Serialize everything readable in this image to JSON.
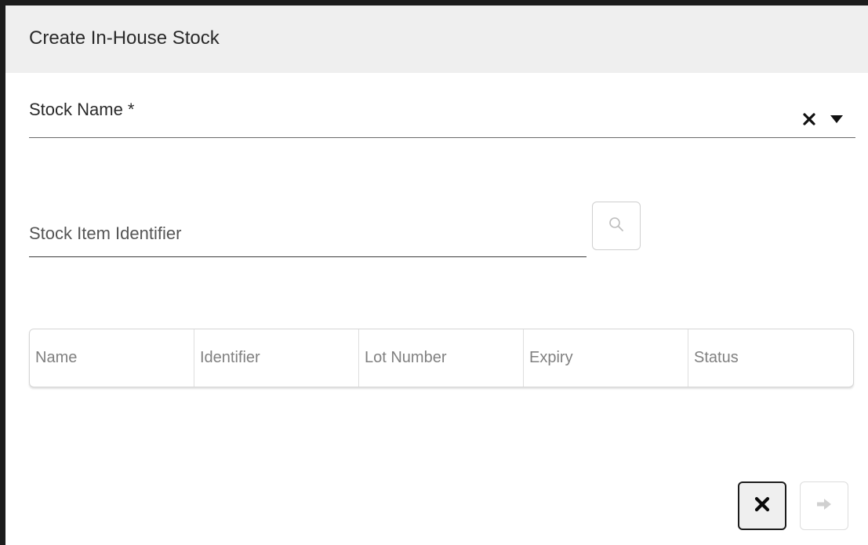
{
  "dialog": {
    "title": "Create In-House Stock"
  },
  "stock_name": {
    "label": "Stock Name *",
    "value": "",
    "icons": {
      "clear": "close-icon",
      "dropdown": "caret-down-icon"
    }
  },
  "identifier": {
    "placeholder": "Stock Item Identifier",
    "value": "",
    "search_icon": "magnifier-icon"
  },
  "table": {
    "columns": [
      "Name",
      "Identifier",
      "Lot Number",
      "Expiry",
      "Status"
    ],
    "rows": []
  },
  "actions": {
    "cancel_icon": "close-icon",
    "next_icon": "arrow-right-icon",
    "next_enabled": false
  }
}
